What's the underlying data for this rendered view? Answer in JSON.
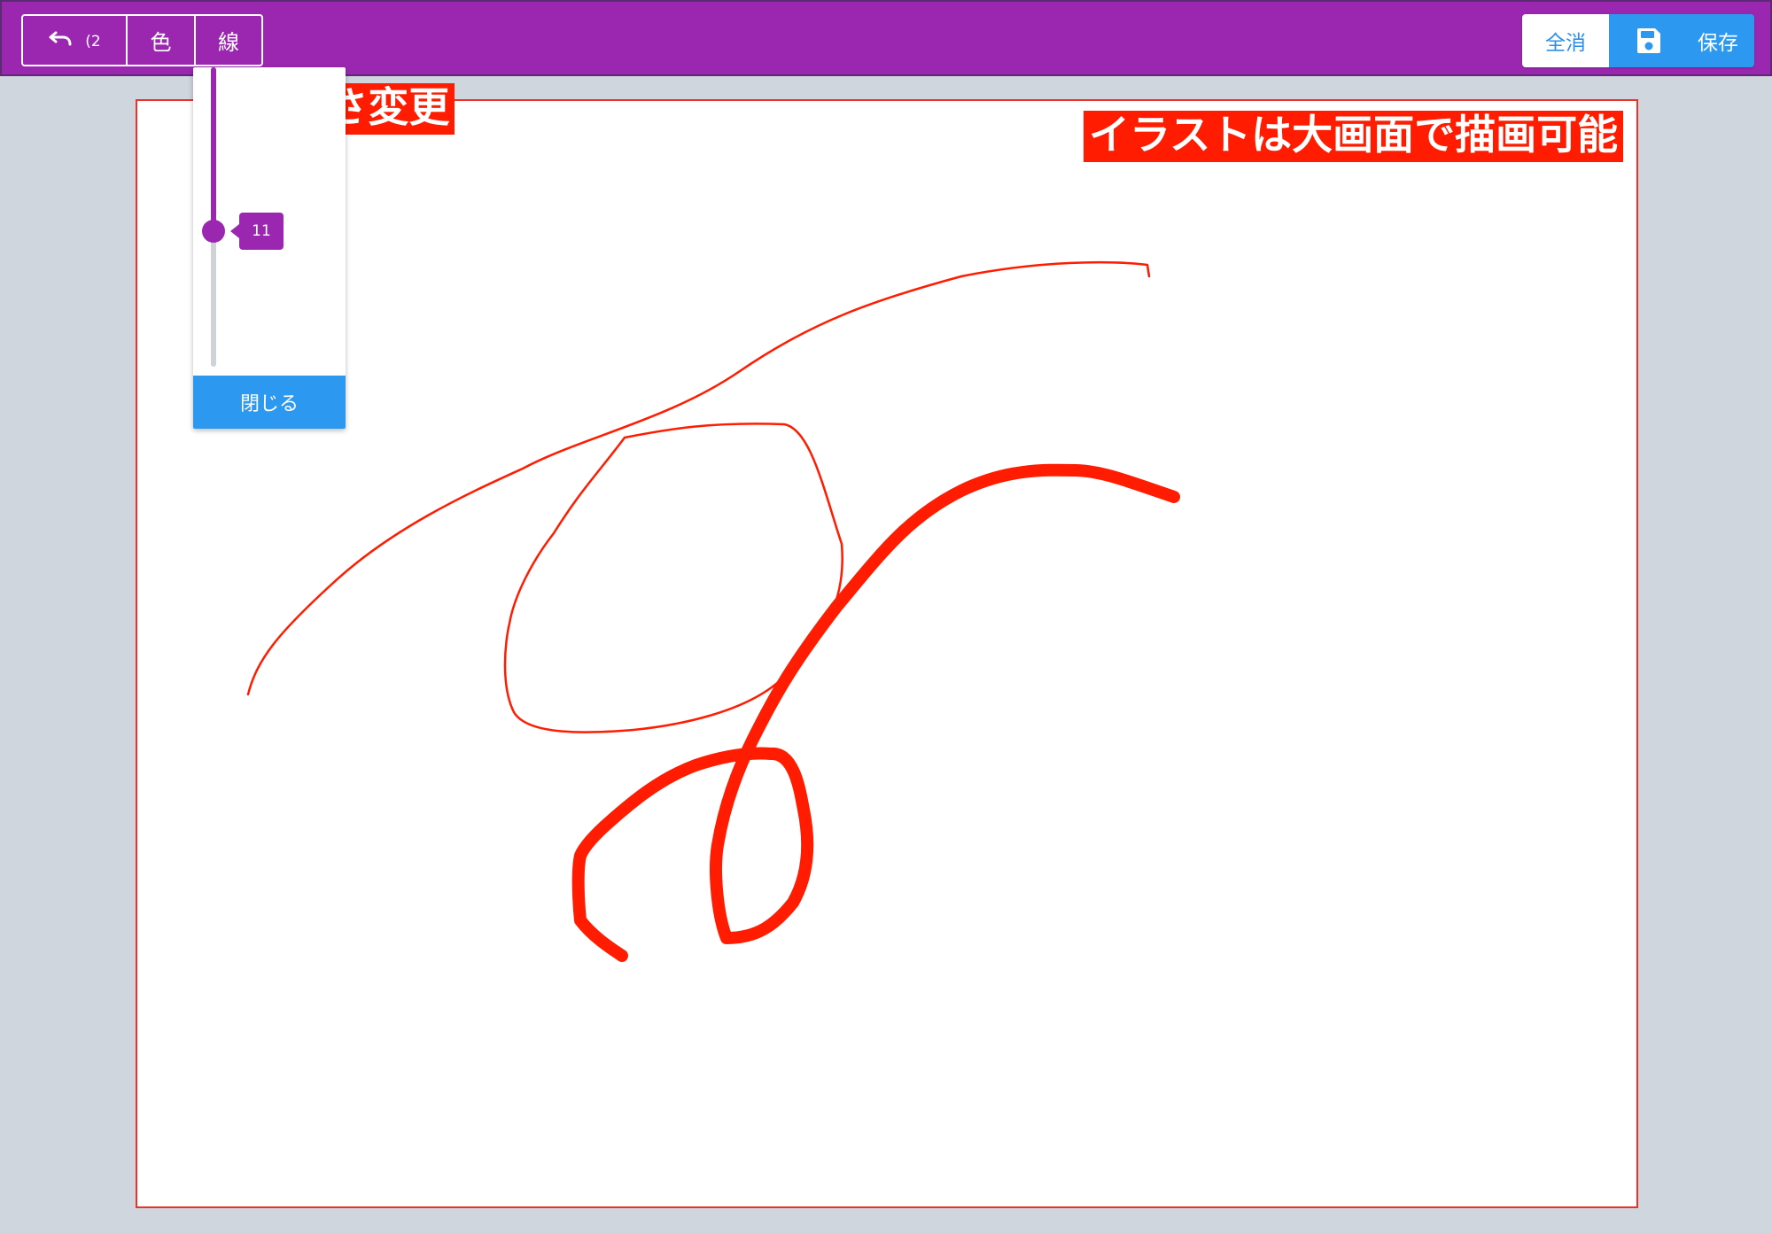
{
  "toolbar": {
    "undo_count": "(2",
    "color_label": "色",
    "line_label": "線",
    "clear_label": "全消",
    "save_label": "保存",
    "background_color": "#9b27b0"
  },
  "slider": {
    "value": "11",
    "close_label": "閉じる"
  },
  "annotations": {
    "thickness": "◀太さ変更",
    "fullscreen": "イラストは大画面で描画可能"
  },
  "colors": {
    "accent": "#9b27b0",
    "primary": "#2d98f0",
    "stroke": "#ff1c00"
  }
}
